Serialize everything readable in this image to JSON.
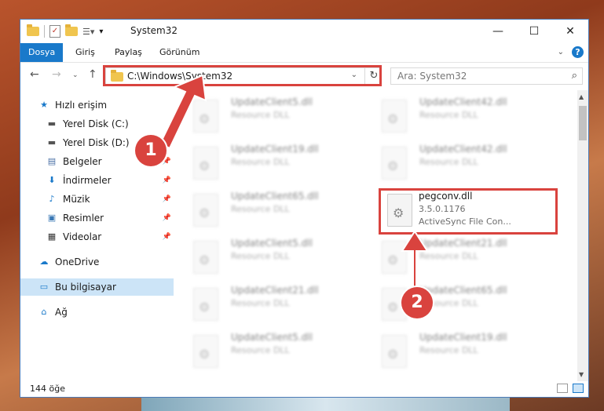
{
  "window": {
    "title": "System32"
  },
  "ribbon": {
    "tabs": [
      "Dosya",
      "Giriş",
      "Paylaş",
      "Görünüm"
    ]
  },
  "address": {
    "path": "C:\\Windows\\System32",
    "search_placeholder": "Ara: System32"
  },
  "sidebar": {
    "quick_access": "Hızlı erişim",
    "items": [
      "Yerel Disk (C:)",
      "Yerel Disk (D:)",
      "Belgeler",
      "İndirmeler",
      "Müzik",
      "Resimler",
      "Videolar"
    ],
    "onedrive": "OneDrive",
    "this_pc": "Bu bilgisayar",
    "network": "Ağ"
  },
  "files": {
    "left": [
      {
        "name": "UpdateClient5.dll",
        "desc": "Resource DLL"
      },
      {
        "name": "UpdateClient19.dll",
        "desc": "Resource DLL"
      },
      {
        "name": "UpdateClient65.dll",
        "desc": "Resource DLL"
      },
      {
        "name": "UpdateClient5.dll",
        "desc": "Resource DLL"
      },
      {
        "name": "UpdateClient21.dll",
        "desc": "Resource DLL"
      },
      {
        "name": "UpdateClient5.dll",
        "desc": "Resource DLL"
      }
    ],
    "right": [
      {
        "name": "UpdateClient42.dll",
        "desc": "Resource DLL"
      },
      {
        "name": "UpdateClient42.dll",
        "desc": "Resource DLL"
      },
      {
        "name": "pegconv.dll",
        "desc": "3.5.0.1176",
        "more": "ActiveSync File Con..."
      },
      {
        "name": "UpdateClient21.dll",
        "desc": "Resource DLL"
      },
      {
        "name": "UpdateClient65.dll",
        "desc": "Resource DLL"
      },
      {
        "name": "UpdateClient19.dll",
        "desc": "Resource DLL"
      }
    ]
  },
  "status": {
    "count": "144 öğe"
  },
  "annotations": {
    "badge1": "1",
    "badge2": "2",
    "color": "#d9433e"
  }
}
